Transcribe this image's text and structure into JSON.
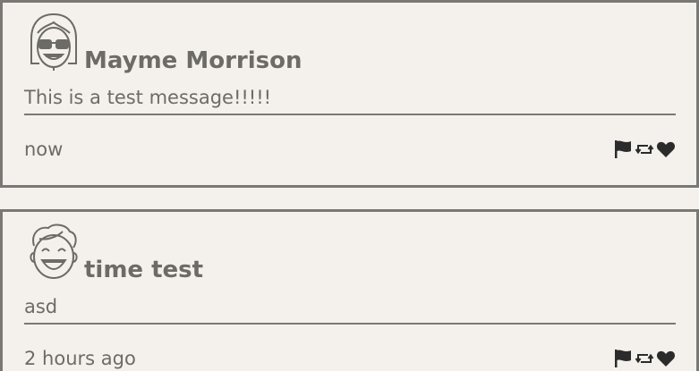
{
  "posts": [
    {
      "avatar_icon": "girl-with-glasses-avatar-icon",
      "username": "Mayme Morrison",
      "message": "This is a test message!!!!!",
      "timestamp": "now",
      "actions": [
        "flag-icon",
        "retweet-icon",
        "heart-icon"
      ]
    },
    {
      "avatar_icon": "laughing-boy-avatar-icon",
      "username": "time test",
      "message": "asd",
      "timestamp": "2 hours ago",
      "actions": [
        "flag-icon",
        "retweet-icon",
        "heart-icon"
      ]
    }
  ],
  "colors": {
    "background": "#f4f1ec",
    "border": "#7a7874",
    "text": "#6d6b66",
    "icon": "#2b2b2b"
  }
}
